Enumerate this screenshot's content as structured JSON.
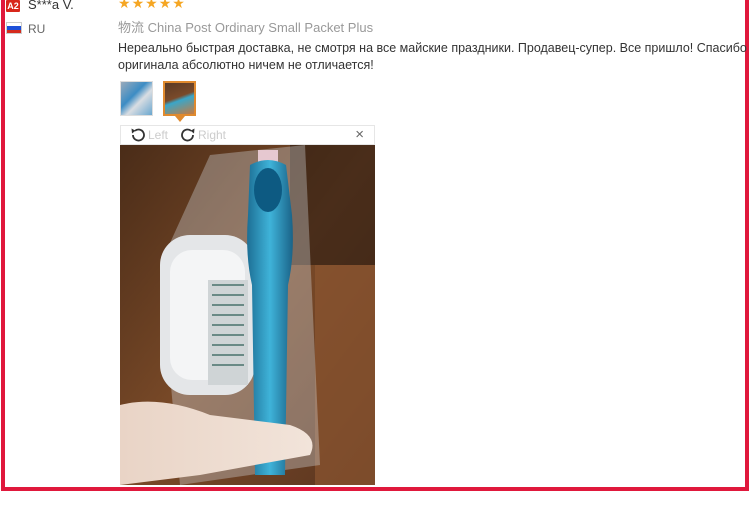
{
  "reviewer": {
    "badge": "A2",
    "name": "S***a V.",
    "country": "RU",
    "flag_colors": [
      "#ffffff",
      "#1c4fd8",
      "#d52b1e"
    ]
  },
  "rating": {
    "stars": 5,
    "max": 5,
    "color": "#f5a623"
  },
  "shipping": {
    "prefix": "物流",
    "method": "China Post Ordinary Small Packet Plus"
  },
  "review": {
    "line1": "Нереально быстрая доставка, не смотря на все майские праздники. Продавец-супер. Все пришло! Спасибо",
    "line2": "оригинала абсолютно ничем не отличается!"
  },
  "thumbnails": [
    {
      "label": "photo-1",
      "selected": false
    },
    {
      "label": "photo-2",
      "selected": true
    }
  ],
  "viewer": {
    "rotate_left_label": "Left",
    "rotate_right_label": "Right",
    "close_glyph": "×",
    "photo_description_icon": "razor-photo"
  },
  "colors": {
    "frame": "#e0183c",
    "badge": "#d8271b",
    "selected_thumb": "#e08a2e"
  }
}
